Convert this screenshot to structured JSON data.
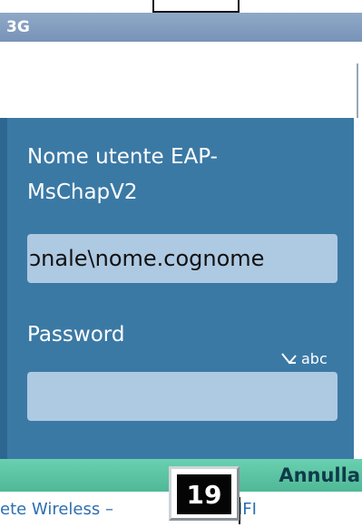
{
  "status_bar": {
    "network": "3G"
  },
  "dialog": {
    "username_label_line1": "Nome utente EAP-",
    "username_label_line2": "MsChapV2",
    "username_value": "ɔnale\\nome.cognome",
    "password_label": "Password",
    "password_value": "",
    "input_mode": "abc"
  },
  "softkeys": {
    "right": "Annulla"
  },
  "footer": {
    "text_left": "ete Wireless –",
    "text_right": "IFI",
    "page_number": "19"
  },
  "colors": {
    "dialog_bg": "#3b79a5",
    "status_bar": "#7f9bbd",
    "softkey_bar": "#5cc4a3",
    "footer_text": "#2c6fb0"
  }
}
